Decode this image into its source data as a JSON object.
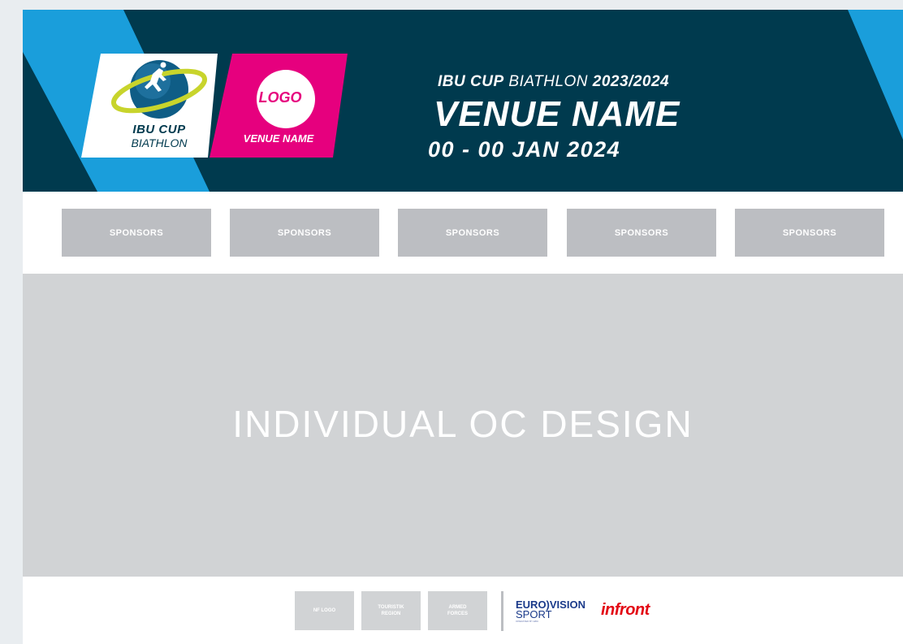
{
  "banner": {
    "ibu_logo": {
      "line1": "IBU CUP",
      "line2": "BIATHLON"
    },
    "oc_logo": {
      "circle_label": "LOGO",
      "venue_label": "VENUE NAME"
    },
    "event_title": {
      "brand": "IBU CUP",
      "sport": "BIATHLON",
      "season": "2023/2024"
    },
    "venue_name": "VENUE NAME",
    "date": "00 - 00 JAN 2024"
  },
  "sponsors": {
    "items": [
      "SPONSORS",
      "SPONSORS",
      "SPONSORS",
      "SPONSORS",
      "SPONSORS"
    ]
  },
  "main": {
    "label": "INDIVIDUAL OC DESIGN"
  },
  "footer": {
    "boxes": [
      {
        "line1": "NF LOGO",
        "line2": ""
      },
      {
        "line1": "TOURISTIK",
        "line2": "REGION"
      },
      {
        "line1": "ARMED",
        "line2": "FORCES"
      }
    ],
    "eurovision": {
      "line1": "EURO)VISION",
      "line2": "SPORT",
      "line3": "OPERATED BY EBU"
    },
    "infront": "infront"
  },
  "colors": {
    "navy": "#003a4e",
    "sky_blue": "#1a9edb",
    "magenta": "#e6007e",
    "lime": "#c8d42c",
    "sponsor_grey": "#bcbec2",
    "panel_grey": "#d1d3d5",
    "eurovision_blue": "#1a3a8a",
    "infront_red": "#e30613"
  }
}
